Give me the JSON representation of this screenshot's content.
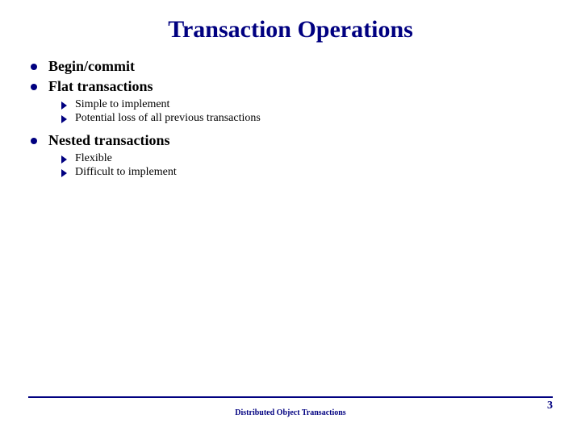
{
  "title": "Transaction Operations",
  "items": [
    {
      "text": "Begin/commit",
      "children": []
    },
    {
      "text": "Flat transactions",
      "children": [
        {
          "text": "Simple to implement"
        },
        {
          "text": "Potential loss of all previous transactions"
        }
      ]
    },
    {
      "text": "Nested transactions",
      "children": [
        {
          "text": "Flexible"
        },
        {
          "text": "Difficult to implement"
        }
      ]
    }
  ],
  "footer": {
    "center": "Distributed Object Transactions",
    "page": "3"
  }
}
